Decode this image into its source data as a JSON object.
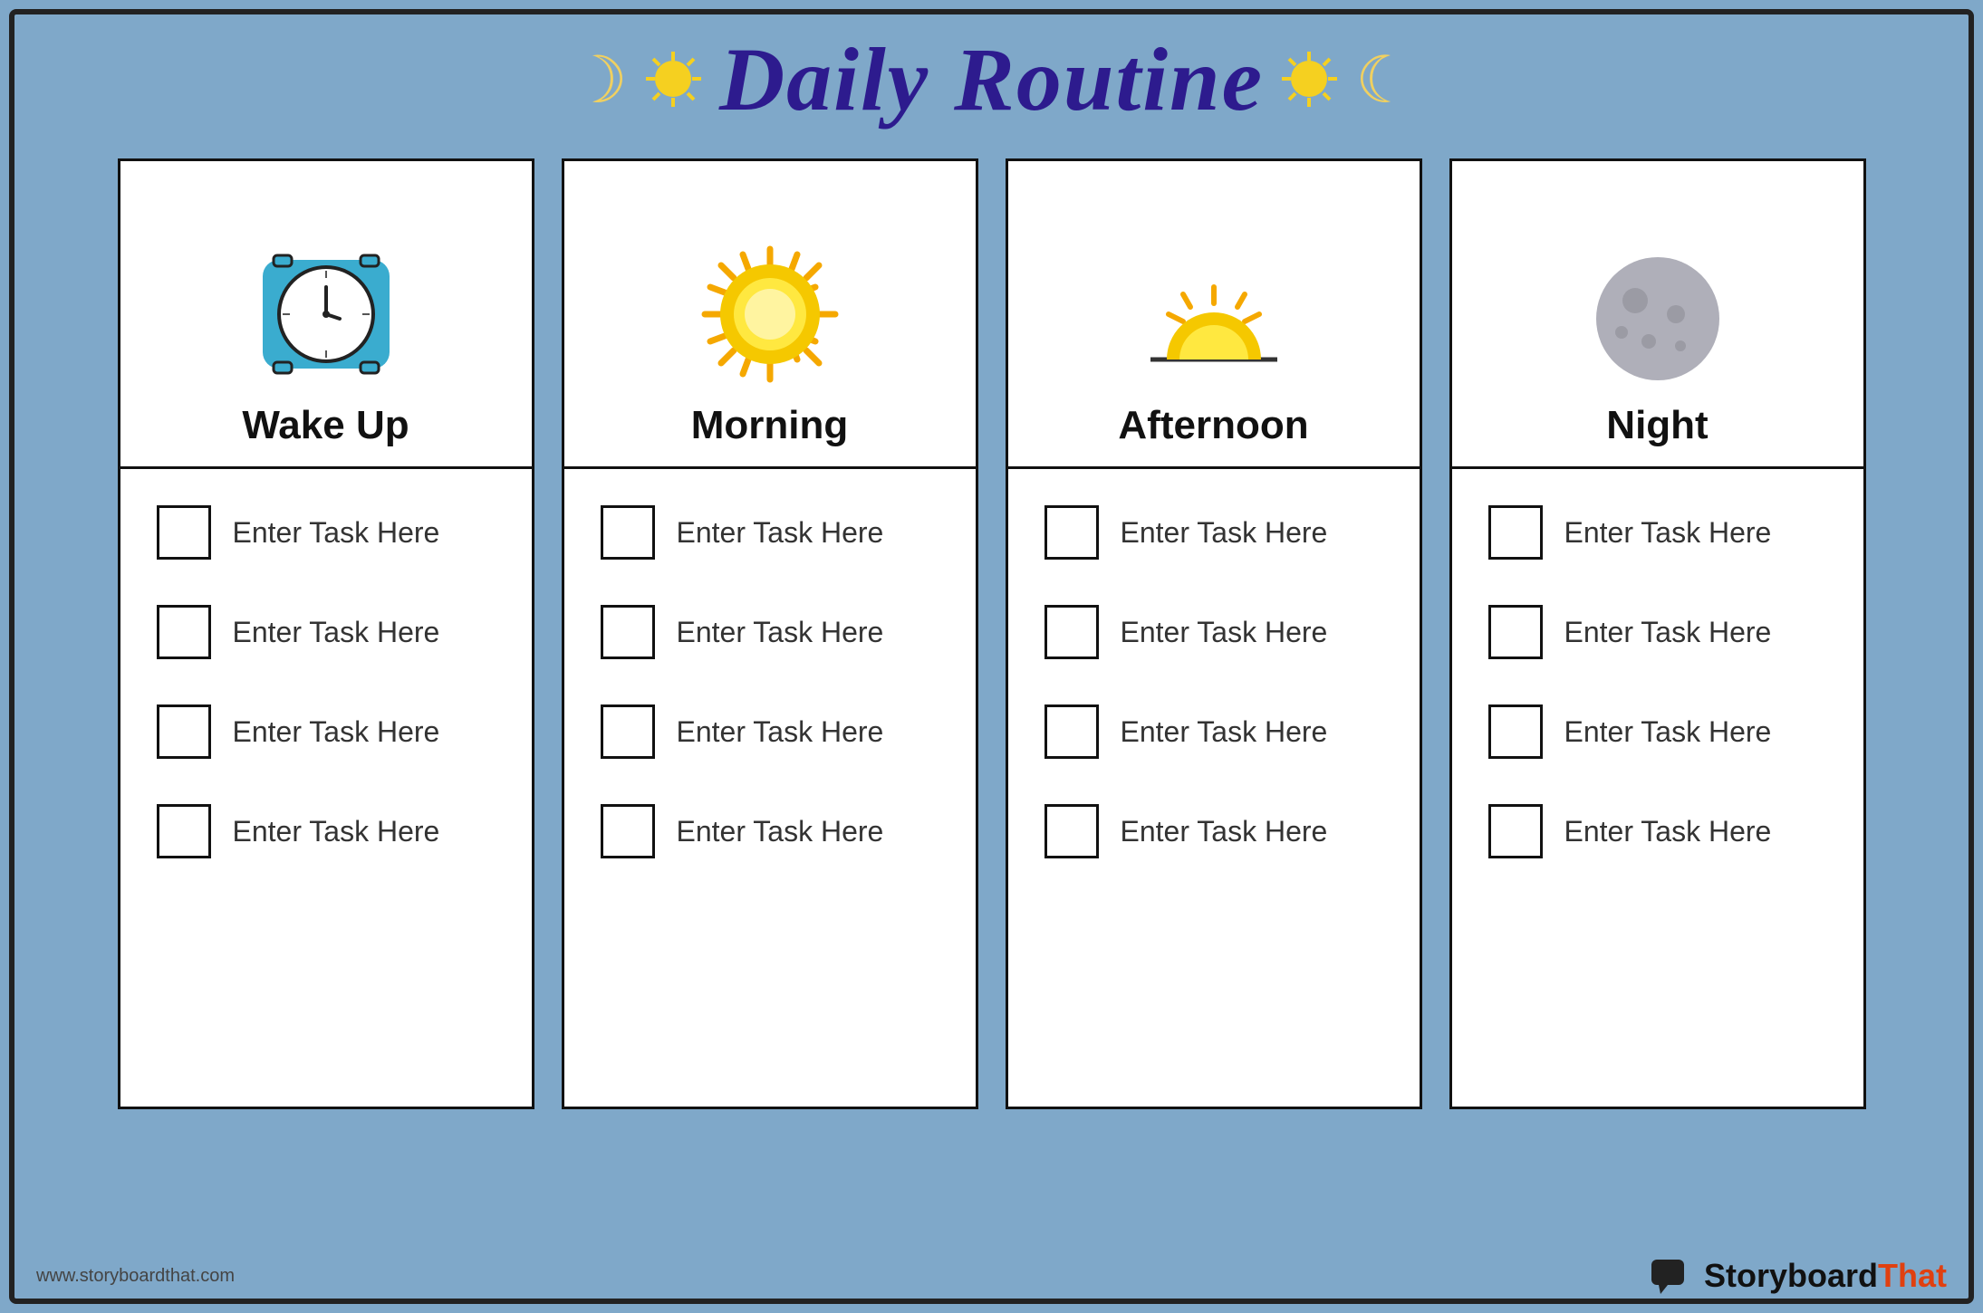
{
  "page": {
    "title": "Daily Routine",
    "background_color": "#7fa8c9",
    "border_color": "#222"
  },
  "header": {
    "title": "Daily Routine",
    "decorators": [
      "🌙",
      "✦",
      "☀",
      "✦",
      "🌙"
    ]
  },
  "columns": [
    {
      "id": "wake-up",
      "title": "Wake Up",
      "icon_type": "clock",
      "tasks": [
        "Enter Task Here",
        "Enter Task Here",
        "Enter Task Here",
        "Enter Task Here"
      ]
    },
    {
      "id": "morning",
      "title": "Morning",
      "icon_type": "sun",
      "tasks": [
        "Enter Task Here",
        "Enter Task Here",
        "Enter Task Here",
        "Enter Task Here"
      ]
    },
    {
      "id": "afternoon",
      "title": "Afternoon",
      "icon_type": "afternoon-sun",
      "tasks": [
        "Enter Task Here",
        "Enter Task Here",
        "Enter Task Here",
        "Enter Task Here"
      ]
    },
    {
      "id": "night",
      "title": "Night",
      "icon_type": "moon",
      "tasks": [
        "Enter Task Here",
        "Enter Task Here",
        "Enter Task Here",
        "Enter Task Here"
      ]
    }
  ],
  "footer": {
    "url": "www.storyboardthat.com",
    "brand_name": "Storyboard",
    "brand_accent": "That"
  }
}
